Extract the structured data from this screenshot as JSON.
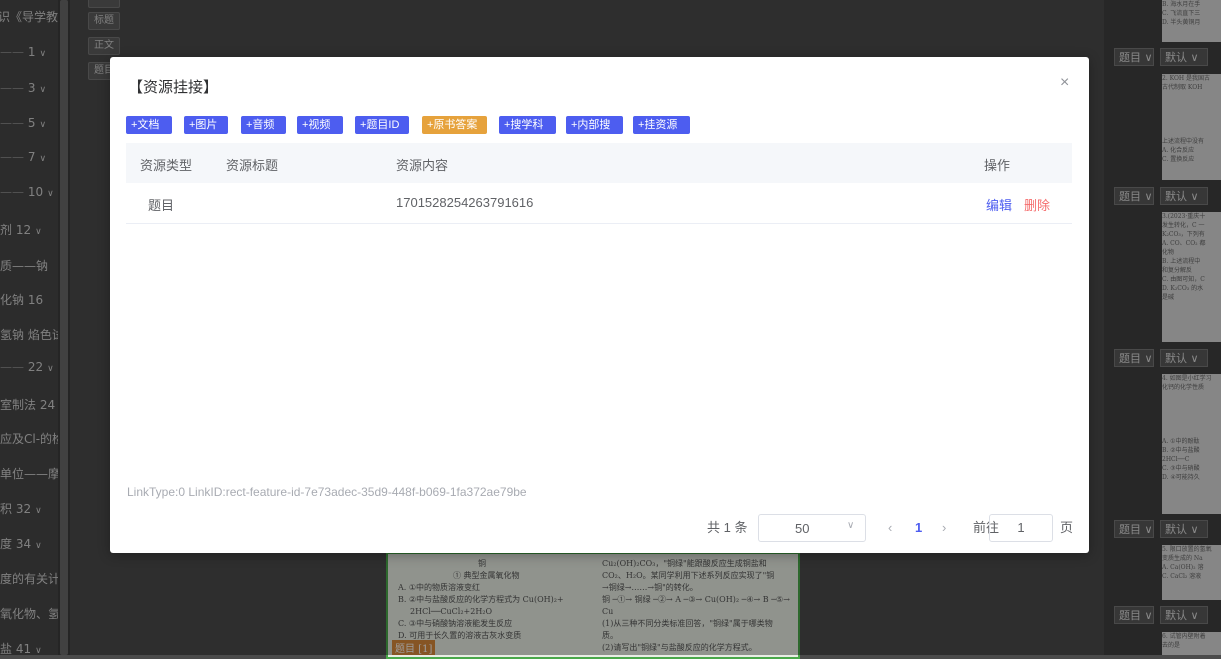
{
  "sidebar": {
    "items": [
      {
        "label": "识《导学教程",
        "num": ""
      },
      {
        "label": "",
        "num": "1"
      },
      {
        "label": "",
        "num": "3"
      },
      {
        "label": "",
        "num": "5"
      },
      {
        "label": "",
        "num": "7"
      },
      {
        "label": "",
        "num": "10"
      },
      {
        "label": "剂",
        "num": "12"
      },
      {
        "label": "质——钠",
        "num": ""
      },
      {
        "label": "化钠",
        "num": "16"
      },
      {
        "label": "氢钠 焰色试",
        "num": ""
      },
      {
        "label": "",
        "num": "22"
      },
      {
        "label": "室制法",
        "num": "24"
      },
      {
        "label": "应及Cl-的检",
        "num": ""
      },
      {
        "label": "单位——摩尔",
        "num": ""
      },
      {
        "label": "积",
        "num": "32"
      },
      {
        "label": "度",
        "num": "34"
      },
      {
        "label": "度的有关计算",
        "num": ""
      },
      {
        "label": "氧化物、氢氧",
        "num": ""
      },
      {
        "label": "盐",
        "num": "41"
      }
    ]
  },
  "tools": {
    "buttons": [
      "标题",
      "正文",
      "题目"
    ]
  },
  "document": {
    "left_lines": [
      "铜",
      "① 典型金属氧化物",
      "A. ①中的物质溶液变红",
      "B. ②中与盐酸反应的化学方程式为 Cu(OH)₂+",
      "2HCl──CuCl₂+2H₂O",
      "C. ③中与硝酸钠溶液能发生反应",
      "D. 可用于长久置的溶液古灰水变质"
    ],
    "right_lines": [
      "Cu₂(OH)₂CO₃，\"铜绿\"能跟酸反应生成铜盐和",
      "CO₂、H₂O。某同学利用下述系列反应实现了\"铜",
      "→铜绿→……→铜\"的转化。",
      "铜 ─①→ 铜绿 ─②→ A ─③→ Cu(OH)₂ ─④→ B ─⑤→ Cu",
      "(1)从三种不同分类标准回答，\"铜绿\"属于哪类物",
      "质。",
      "(2)请写出\"铜绿\"与盐酸反应的化学方程式。"
    ],
    "tag": "题目 [1]"
  },
  "right_panel": {
    "select_type": "题目",
    "select_default": "默认",
    "thumbs": [
      [
        "B. 海水月在手",
        "C. 飞流直下三",
        "D. 半头黄铜月"
      ],
      [
        "2. KOH 是我国古",
        "古代制取 KOH",
        "",
        "上述流程中没有",
        "A. 化合反应",
        "C. 置换反应"
      ],
      [
        "3.(2023·重庆十",
        "发生转化，C 一",
        "K₂CO₃，下列有",
        "A. CO、CO₂ 都",
        "化物",
        "B. 上述流程中",
        "和复分解反",
        "C. 由图可知，C",
        "D. K₂CO₃ 的水",
        "是碱"
      ],
      [
        "4. 如图是小红学习",
        "化钙的化学性质",
        "",
        "",
        "A. ①中的酚酞",
        "B. ②中与盐酸",
        "2HCl──C",
        "C. ③中与硝酸",
        "D. ④可能持久"
      ],
      [
        "5. 限口放置的氢氧",
        "变质生成的 Na",
        "A. Ca(OH)₂ 溶",
        "C. CaCl₂ 溶液"
      ],
      [
        "6. 试管内壁附着",
        "去的是"
      ]
    ]
  },
  "modal": {
    "title": "【资源挂接】",
    "close_icon": "×",
    "buttons": [
      "+文档",
      "+图片",
      "+音频",
      "+视频",
      "+题目ID",
      "+原书答案",
      "+搜学科",
      "+内部搜",
      "+挂资源"
    ],
    "columns": {
      "type": "资源类型",
      "title": "资源标题",
      "content": "资源内容",
      "action": "操作"
    },
    "rows": [
      {
        "type": "题目",
        "title": "",
        "content": "1701528254263791616",
        "edit": "编辑",
        "delete": "删除"
      }
    ],
    "link_info": "LinkType:0 LinkID:rect-feature-id-7e73adec-35d9-448f-b069-1fa372ae79be",
    "pagination": {
      "total": "共 1 条",
      "page_size": "50",
      "prev": "‹",
      "current_page": "1",
      "next": "›",
      "goto_label": "前往",
      "goto_value": "1",
      "page_unit": "页"
    }
  },
  "colors": {
    "primary": "#4d5df0",
    "orange": "#e6a23c",
    "danger": "#f56c6c"
  }
}
